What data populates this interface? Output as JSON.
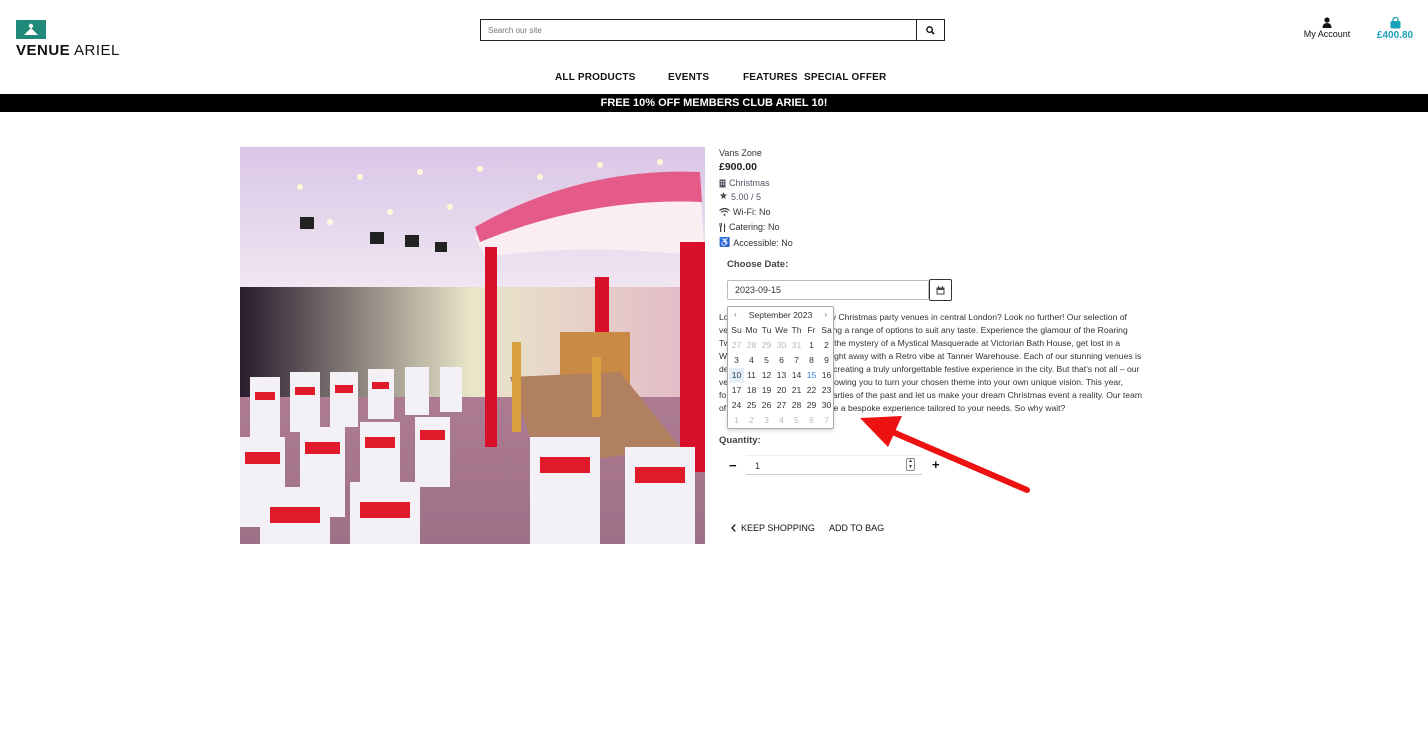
{
  "brand": {
    "name_part1": "VENUE",
    "name_part2": "ARIEL",
    "logo_color": "#1f8a7a"
  },
  "search": {
    "placeholder": "Search our site"
  },
  "account": {
    "label": "My Account"
  },
  "cart": {
    "total": "£400.80",
    "color": "#17a2b8"
  },
  "nav": {
    "items": [
      "ALL PRODUCTS",
      "EVENTS",
      "FEATURES",
      "SPECIAL OFFER"
    ]
  },
  "banner": {
    "text": "FREE 10% OFF MEMBERS CLUB ARIEL 10!"
  },
  "product": {
    "name": "Vans Zone",
    "price": "£900.00",
    "category": "Christmas",
    "rating": "5.00 / 5",
    "wifi": "Wi-Fi: No",
    "catering": "Catering: No",
    "accessible": "Accessible: No",
    "description_l1": "Lo                                ordinary Christmas party venues in central London? Look no further! Our selection of",
    "description_l2": "ve                                s, offering a range of options to suit any taste. Experience the glamour of the Roaring",
    "description_l3": "Tw                                ulge in the mystery of a Mystical Masquerade at Victorian Bath House, get lost in a",
    "description_l4": "W                                 e the night away with a Retro vibe at Tanner Warehouse. Each of our stunning venues is",
    "description_l5": "de                                ments, creating a truly unforgettable festive experience in the city. But that's not all – our",
    "description_l6": "ve                                able, allowing you to turn your chosen theme into your own unique vision. This year,",
    "description_l7": "fo                                stmas parties of the past and let us make your dream Christmas event a reality. Our team",
    "description_l8": "of                                 to create a bespoke experience tailored to your needs. So why wait?"
  },
  "booking": {
    "choose_date_label": "Choose Date:",
    "date_value": "2023-09-15",
    "quantity_label": "Quantity:",
    "quantity_value": "1",
    "minus": "−",
    "plus": "+",
    "keep_shopping": "KEEP SHOPPING",
    "add_to_bag": "ADD TO BAG"
  },
  "datepicker": {
    "month_label": "September 2023",
    "prev": "‹",
    "next": "›",
    "weekdays": [
      "Su",
      "Mo",
      "Tu",
      "We",
      "Th",
      "Fr",
      "Sa"
    ],
    "weeks": [
      [
        "27",
        "28",
        "29",
        "30",
        "31",
        "1",
        "2"
      ],
      [
        "3",
        "4",
        "5",
        "6",
        "7",
        "8",
        "9"
      ],
      [
        "10",
        "11",
        "12",
        "13",
        "14",
        "15",
        "16"
      ],
      [
        "17",
        "18",
        "19",
        "20",
        "21",
        "22",
        "23"
      ],
      [
        "24",
        "25",
        "26",
        "27",
        "28",
        "29",
        "30"
      ],
      [
        "1",
        "2",
        "3",
        "4",
        "5",
        "6",
        "7"
      ]
    ],
    "today": "10",
    "selected": "15"
  },
  "annotation": {
    "arrow_color": "#ee1111"
  }
}
